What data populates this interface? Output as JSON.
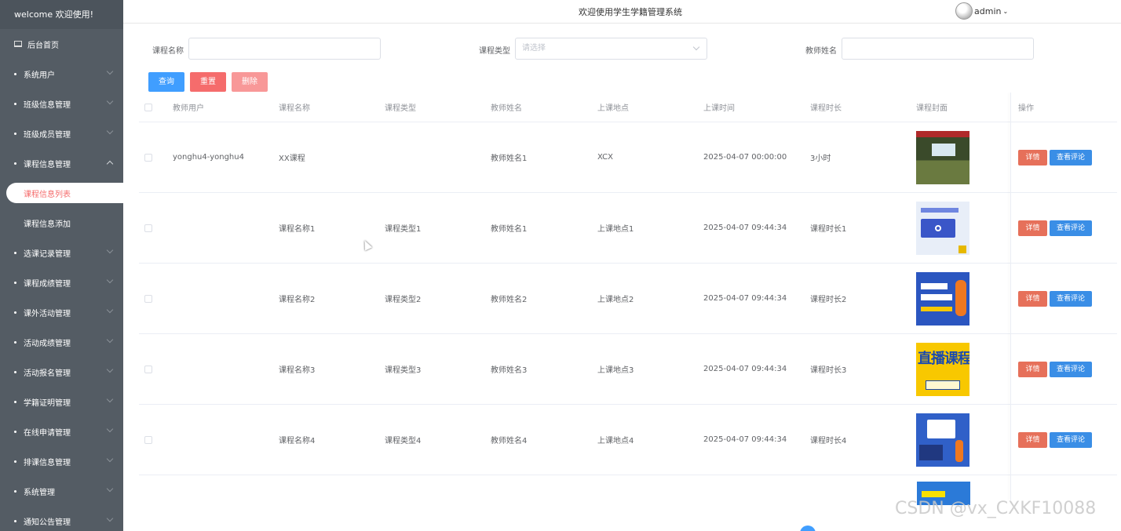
{
  "sidebar": {
    "welcome": "welcome 欢迎使用!",
    "home": "后台首页",
    "items": [
      {
        "label": "系统用户"
      },
      {
        "label": "班级信息管理"
      },
      {
        "label": "班级成员管理"
      },
      {
        "label": "课程信息管理"
      },
      {
        "label": "选课记录管理"
      },
      {
        "label": "课程成绩管理"
      },
      {
        "label": "课外活动管理"
      },
      {
        "label": "活动成绩管理"
      },
      {
        "label": "活动报名管理"
      },
      {
        "label": "学籍证明管理"
      },
      {
        "label": "在线申请管理"
      },
      {
        "label": "排课信息管理"
      },
      {
        "label": "系统管理"
      },
      {
        "label": "通知公告管理"
      }
    ],
    "sub_items": [
      {
        "label": "课程信息列表"
      },
      {
        "label": "课程信息添加"
      }
    ]
  },
  "header": {
    "title": "欢迎使用学生学籍管理系统",
    "user": "admin"
  },
  "search": {
    "course_name_label": "课程名称",
    "course_type_label": "课程类型",
    "course_type_placeholder": "请选择",
    "teacher_name_label": "教师姓名"
  },
  "buttons": {
    "query": "查询",
    "reset": "重置",
    "delete": "删除"
  },
  "table": {
    "headers": [
      "教师用户",
      "课程名称",
      "课程类型",
      "教师姓名",
      "上课地点",
      "上课时间",
      "课程时长",
      "课程封面",
      "操作"
    ],
    "rows": [
      {
        "teacher_user": "yonghu4-yonghu4",
        "course_name": "XX课程",
        "course_type": "",
        "teacher_name": "教师姓名1",
        "location": "XCX",
        "time": "2025-04-07 00:00:00",
        "duration": "3小时"
      },
      {
        "teacher_user": "",
        "course_name": "课程名称1",
        "course_type": "课程类型1",
        "teacher_name": "教师姓名1",
        "location": "上课地点1",
        "time": "2025-04-07 09:44:34",
        "duration": "课程时长1"
      },
      {
        "teacher_user": "",
        "course_name": "课程名称2",
        "course_type": "课程类型2",
        "teacher_name": "教师姓名2",
        "location": "上课地点2",
        "time": "2025-04-07 09:44:34",
        "duration": "课程时长2"
      },
      {
        "teacher_user": "",
        "course_name": "课程名称3",
        "course_type": "课程类型3",
        "teacher_name": "教师姓名3",
        "location": "上课地点3",
        "time": "2025-04-07 09:44:34",
        "duration": "课程时长3"
      },
      {
        "teacher_user": "",
        "course_name": "课程名称4",
        "course_type": "课程类型4",
        "teacher_name": "教师姓名4",
        "location": "上课地点4",
        "time": "2025-04-07 09:44:34",
        "duration": "课程时长4"
      }
    ],
    "op_detail": "详情",
    "op_comment": "查看评论",
    "cover4_text": "直播课程"
  },
  "watermark": "CSDN @vx_CXKF10088",
  "colors": {
    "sidebar_bg": "#545c64",
    "primary": "#409eff",
    "danger": "#f56c6c"
  }
}
